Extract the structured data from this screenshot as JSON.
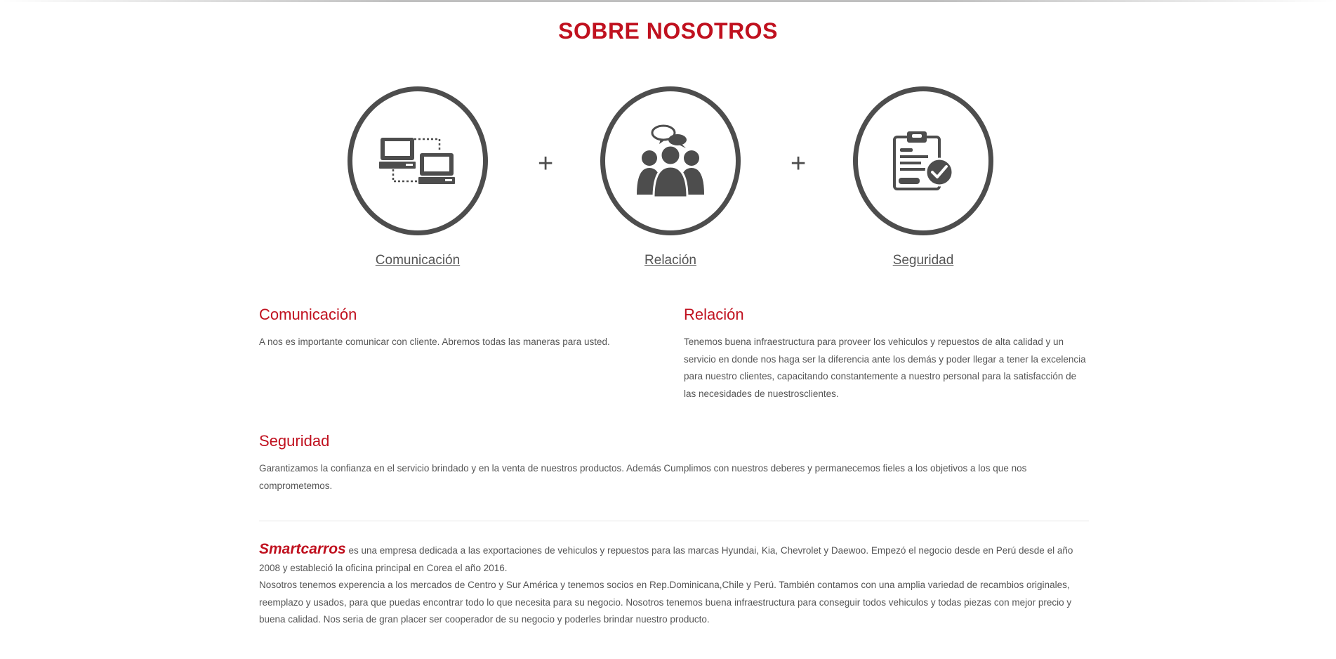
{
  "header": {
    "title": "SOBRE NOSOTROS"
  },
  "features": [
    {
      "label": "Comunicación",
      "icon": "computers-network-icon"
    },
    {
      "label": "Relación",
      "icon": "people-chat-icon"
    },
    {
      "label": "Seguridad",
      "icon": "clipboard-check-icon"
    }
  ],
  "separators": {
    "plus": "+"
  },
  "sections": {
    "comunicacion": {
      "title": "Comunicación",
      "text": "A nos es importante comunicar con cliente. Abremos todas las maneras para usted."
    },
    "relacion": {
      "title": "Relación",
      "text": "Tenemos buena infraestructura para proveer los vehiculos y repuestos de alta calidad y un servicio en donde nos haga ser la diferencia ante los demás y poder llegar a tener la excelencia para nuestro clientes, capacitando constantemente a nuestro personal para la satisfacción de las necesidades de nuestrosclientes."
    },
    "seguridad": {
      "title": "Seguridad",
      "text": "Garantizamos la confianza en el servicio brindado y en la venta de nuestros productos. Además Cumplimos con nuestros deberes y permanecemos fieles a los objetivos a los que nos comprometemos."
    }
  },
  "about": {
    "brand": "Smartcarros",
    "paragraph1": " es una empresa dedicada a las exportaciones de vehiculos y repuestos para las marcas Hyundai, Kia, Chevrolet y Daewoo. Empezó el negocio desde en Perú desde el año 2008 y estableció la oficina principal en Corea el año 2016.",
    "paragraph2": "Nosotros tenemos experencia a los mercados de Centro y Sur América y tenemos socios en Rep.Dominicana,Chile y Perú. También contamos con una amplia variedad de recambios originales, reemplazo y usados, para que puedas encontrar todo lo que necesita para su negocio. Nosotros tenemos buena infraestructura para conseguir todos vehiculos y todas piezas con mejor precio y buena calidad. Nos seria de gran placer ser cooperador de su negocio y poderles brindar nuestro producto."
  },
  "colors": {
    "accent": "#c0111f",
    "icon": "#4d4d4d",
    "text": "#555555"
  }
}
